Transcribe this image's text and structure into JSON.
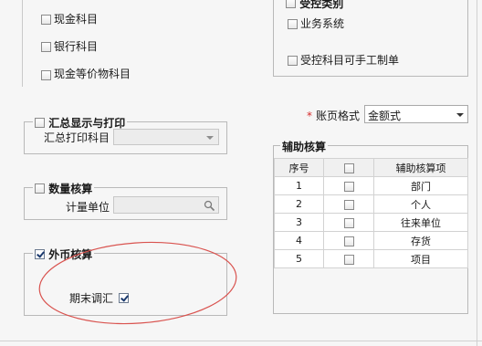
{
  "left": {
    "cash_subject": "现金科目",
    "bank_subject": "银行科目",
    "cash_equiv_subject": "现金等价物科目",
    "summary_group": {
      "title": "汇总显示与打印",
      "print_subject_label": "汇总打印科目",
      "print_subject_value": ""
    },
    "quantity_group": {
      "title": "数量核算",
      "unit_label": "计量单位",
      "unit_value": ""
    },
    "foreign_group": {
      "title": "外币核算",
      "period_end_label": "期末调汇"
    }
  },
  "right": {
    "controlled_group": {
      "title": "受控类别",
      "business_system": "业务系统",
      "manual_voucher": "受控科目可手工制单"
    },
    "ledger_format": {
      "label": "账页格式",
      "required_mark": "*",
      "value": "金额式"
    },
    "aux_group": {
      "title": "辅助核算",
      "columns": [
        "序号",
        "",
        "辅助核算项"
      ],
      "rows": [
        {
          "no": "1",
          "item": "部门"
        },
        {
          "no": "2",
          "item": "个人"
        },
        {
          "no": "3",
          "item": "往来单位"
        },
        {
          "no": "4",
          "item": "存货"
        },
        {
          "no": "5",
          "item": "项目"
        }
      ]
    }
  },
  "icons": {
    "search": "search-icon",
    "dropdown": "chevron-down-icon"
  },
  "colors": {
    "annotation_ellipse": "#d9534f",
    "checked_mark": "#1b3a6e"
  }
}
